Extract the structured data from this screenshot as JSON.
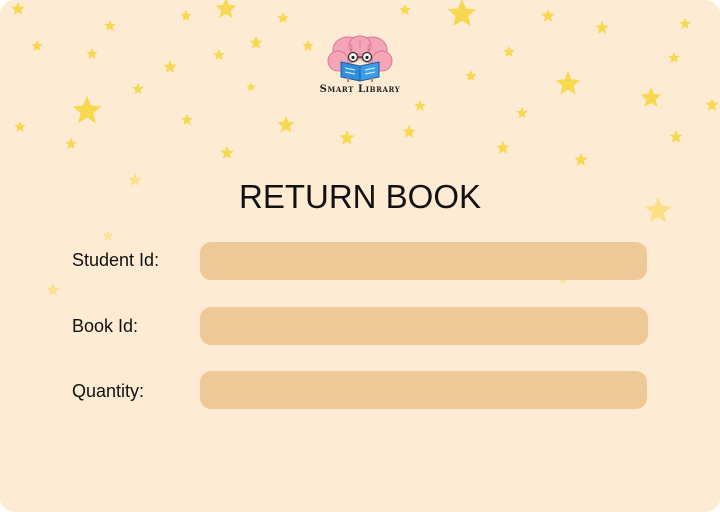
{
  "brand": {
    "name": "Smart Library",
    "logo_icon": "brain-reading-book-icon"
  },
  "form": {
    "title": "RETURN BOOK",
    "fields": [
      {
        "label": "Student Id:",
        "value": ""
      },
      {
        "label": "Book Id:",
        "value": ""
      },
      {
        "label": "Quantity:",
        "value": ""
      }
    ]
  },
  "colors": {
    "background": "#fdebd3",
    "input_fill": "#edc998",
    "star": "#f8d84e",
    "text": "#111111"
  }
}
